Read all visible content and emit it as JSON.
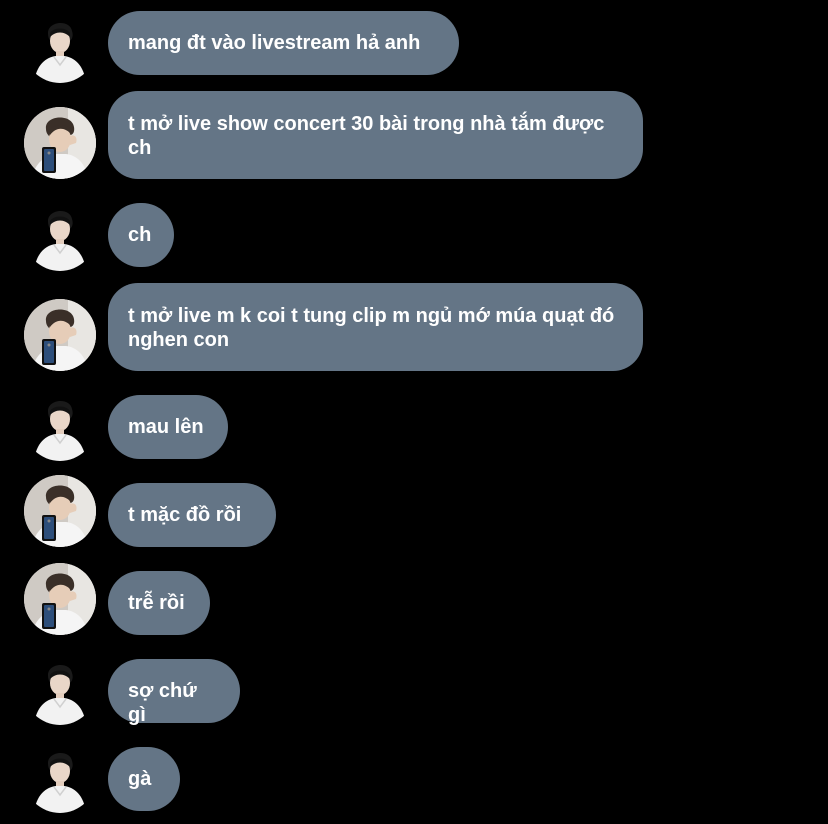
{
  "conversation": {
    "messages": [
      {
        "sender": "a",
        "text": "mang đt vào livestream hả anh"
      },
      {
        "sender": "b",
        "text": "t mở live show concert 30 bài trong nhà tắm được ch"
      },
      {
        "sender": "a",
        "text": "ch"
      },
      {
        "sender": "b",
        "text": "t mở live m k coi t tung clip m ngủ mớ múa quạt đó nghen con"
      },
      {
        "sender": "a",
        "text": "mau lên"
      },
      {
        "sender": "b",
        "text": "t mặc đồ rồi"
      },
      {
        "sender": "b",
        "text": "trễ rồi"
      },
      {
        "sender": "a",
        "text": "sợ chứ gì"
      },
      {
        "sender": "a",
        "text": "gà"
      }
    ]
  },
  "colors": {
    "background": "#000000",
    "bubble": "#647586",
    "text": "#ffffff"
  },
  "icons": {
    "avatar_a": "avatar-boy-white-shirt-icon",
    "avatar_b": "avatar-boy-mirror-selfie-icon"
  }
}
